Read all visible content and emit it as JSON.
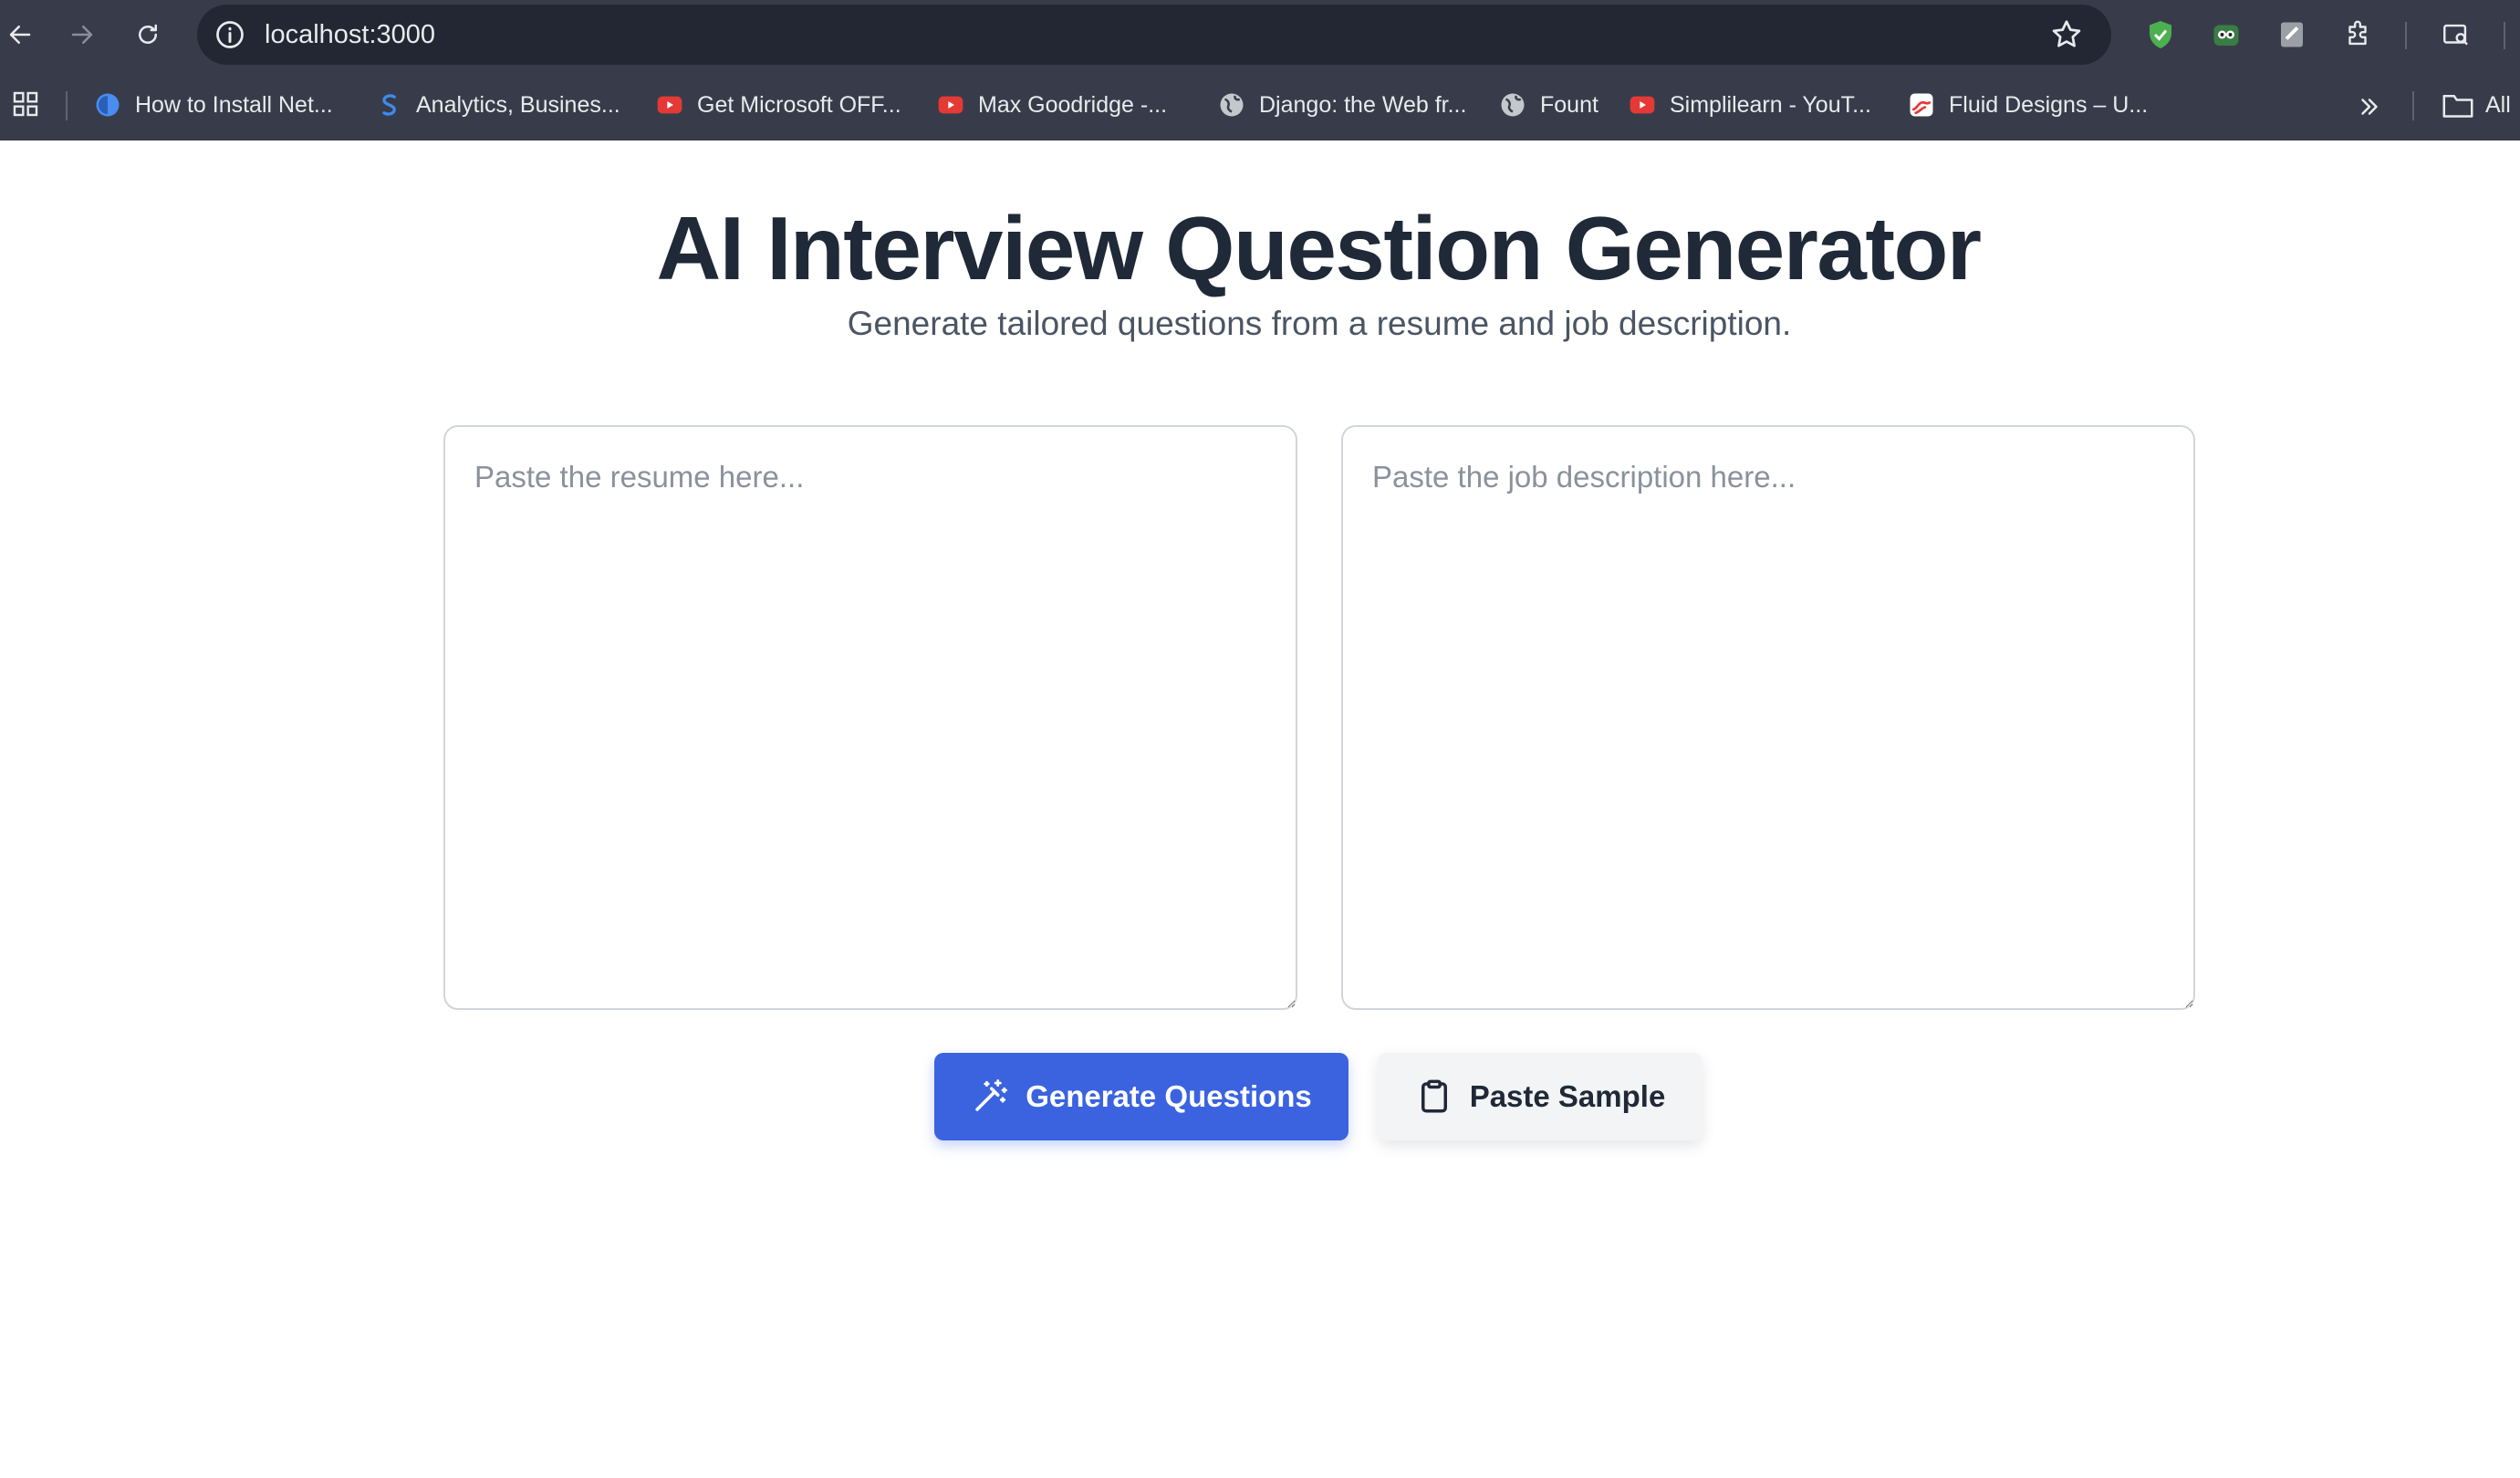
{
  "browser": {
    "url": "localhost:3000",
    "bookmarks": [
      {
        "label": "How to Install Net...",
        "icon": "blue-circle-favicon-icon"
      },
      {
        "label": "Analytics, Busines...",
        "icon": "s-logo-favicon-icon"
      },
      {
        "label": "Get Microsoft OFF...",
        "icon": "youtube-icon"
      },
      {
        "label": "Max Goodridge -...",
        "icon": "youtube-icon"
      },
      {
        "label": "Django: the Web fr...",
        "icon": "globe-icon"
      },
      {
        "label": "Fount",
        "icon": "globe-icon"
      },
      {
        "label": "Simplilearn - YouT...",
        "icon": "youtube-icon"
      },
      {
        "label": "Fluid Designs – U...",
        "icon": "fluid-designs-favicon-icon"
      }
    ],
    "all_bookmarks_label": "All"
  },
  "page": {
    "title": "AI Interview Question Generator",
    "subtitle": "Generate tailored questions from a resume and job description.",
    "resume": {
      "value": "",
      "placeholder": "Paste the resume here..."
    },
    "job_description": {
      "value": "",
      "placeholder": "Paste the job description here..."
    },
    "generate_button": {
      "label": "Generate Questions",
      "icon": "magic-wand-icon"
    },
    "sample_button": {
      "label": "Paste Sample",
      "icon": "clipboard-icon"
    }
  },
  "colors": {
    "chrome_bg": "#383c4a",
    "omnibox_bg": "#232733",
    "primary": "#3b63e0",
    "title_text": "#1f2937",
    "subtitle_text": "#4b5563"
  }
}
